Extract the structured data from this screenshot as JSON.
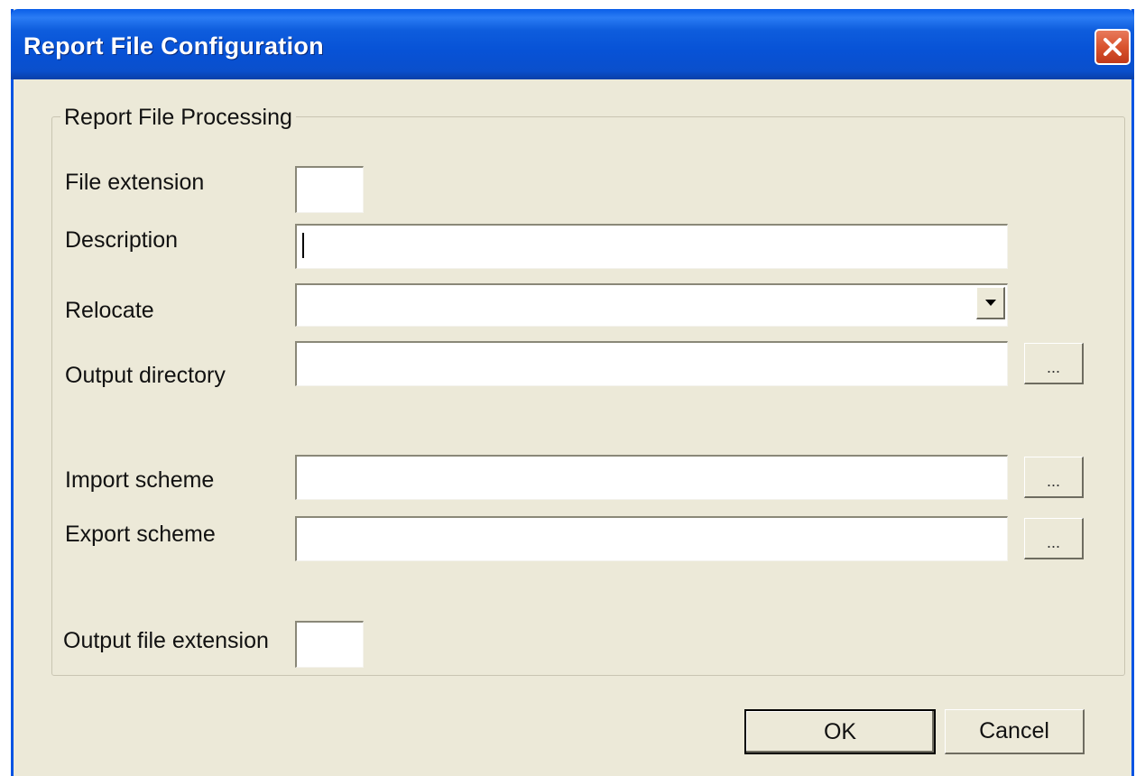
{
  "window": {
    "title": "Report File Configuration",
    "close_icon": "close-icon"
  },
  "group": {
    "legend": "Report File Processing"
  },
  "fields": {
    "file_extension": {
      "label": "File extension",
      "value": ""
    },
    "description": {
      "label": "Description",
      "value": ""
    },
    "relocate": {
      "label": "Relocate",
      "value": ""
    },
    "output_directory": {
      "label": "Output directory",
      "value": ""
    },
    "import_scheme": {
      "label": "Import scheme",
      "value": ""
    },
    "export_scheme": {
      "label": "Export scheme",
      "value": ""
    },
    "output_file_extension": {
      "label": "Output file extension",
      "value": ""
    }
  },
  "browse_label": "...",
  "buttons": {
    "ok": "OK",
    "cancel": "Cancel"
  },
  "colors": {
    "titlebar": "#0752d6",
    "dialog_bg": "#ece9d8",
    "close_button": "#d9542e"
  }
}
